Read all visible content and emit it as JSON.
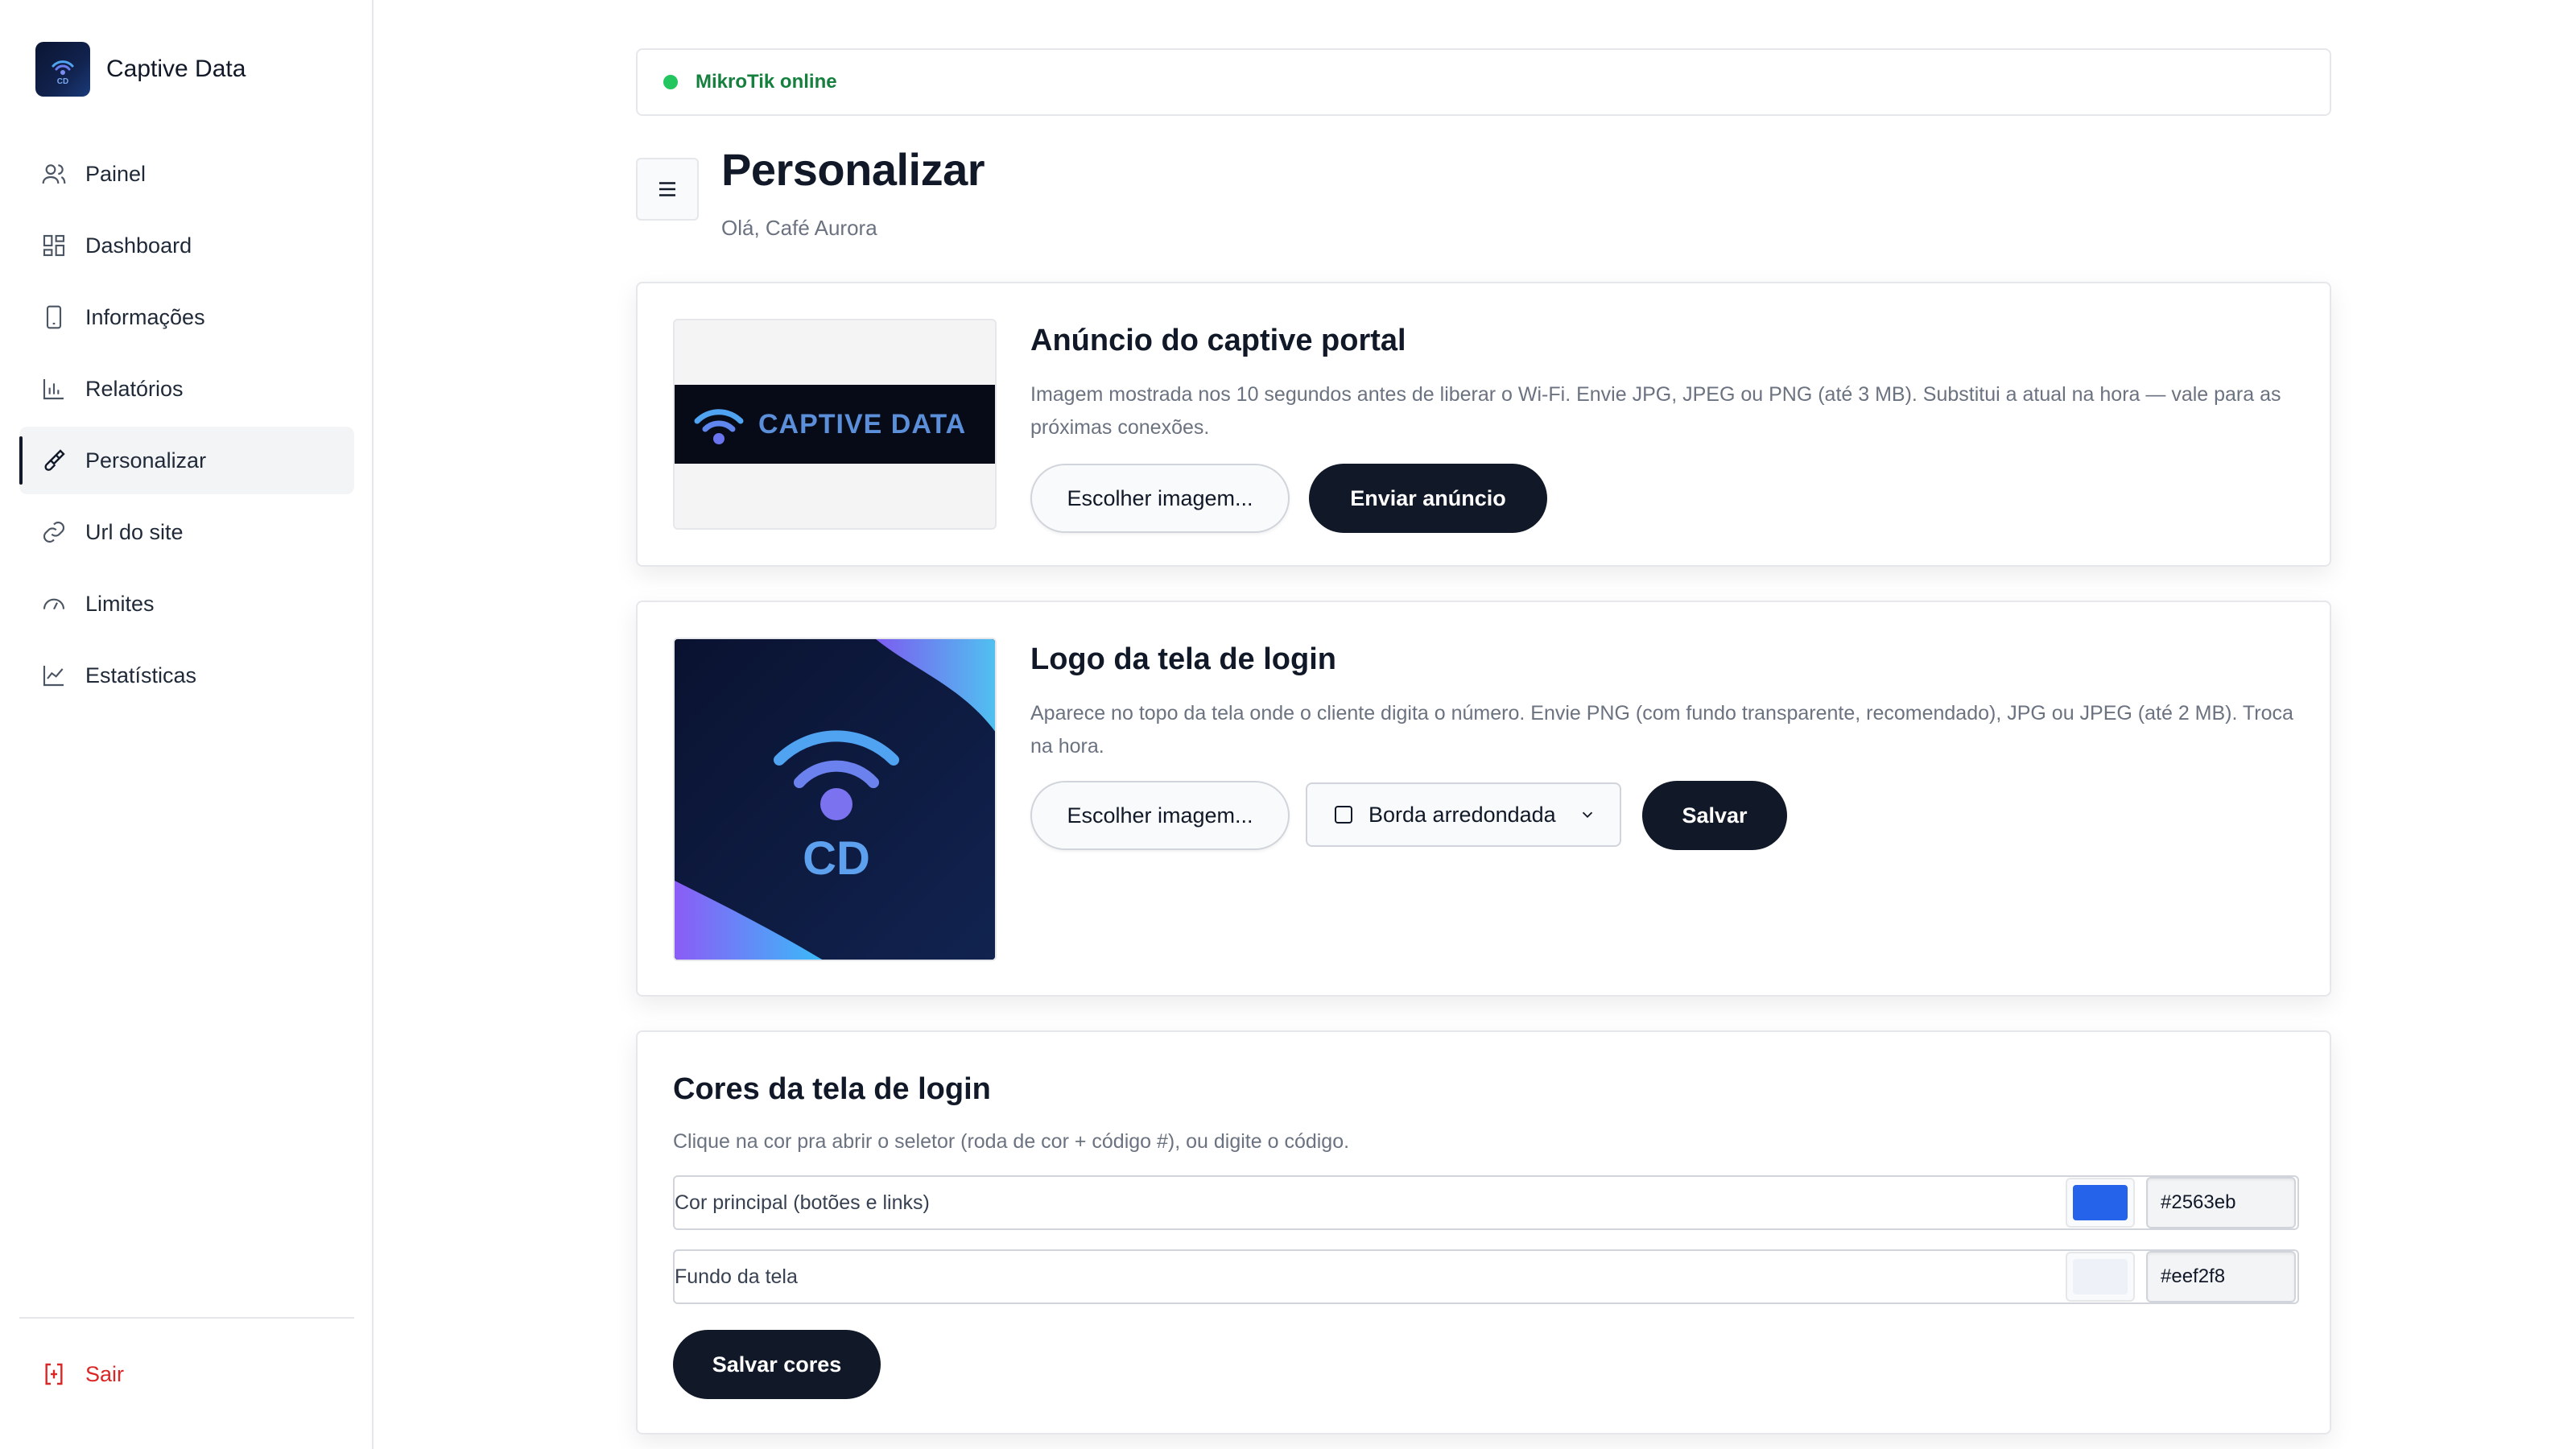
{
  "app": {
    "name": "Captive Data"
  },
  "sidebar": {
    "items": [
      {
        "label": "Painel",
        "icon": "users-icon"
      },
      {
        "label": "Dashboard",
        "icon": "grid-icon"
      },
      {
        "label": "Informações",
        "icon": "phone-icon"
      },
      {
        "label": "Relatórios",
        "icon": "bar-chart-icon"
      },
      {
        "label": "Personalizar",
        "icon": "brush-icon",
        "active": true
      },
      {
        "label": "Url do site",
        "icon": "link-icon"
      },
      {
        "label": "Limites",
        "icon": "gauge-icon"
      },
      {
        "label": "Estatísticas",
        "icon": "line-chart-icon"
      }
    ],
    "logout": "Sair"
  },
  "status": {
    "text": "MikroTik online",
    "color": "#22c55e"
  },
  "header": {
    "title": "Personalizar",
    "greeting": "Olá, Café Aurora"
  },
  "ad_card": {
    "title": "Anúncio do captive portal",
    "description": "Imagem mostrada nos 10 segundos antes de liberar o Wi-Fi. Envie JPG, JPEG ou PNG (até 3 MB). Substitui a atual na hora — vale para as próximas conexões.",
    "choose_label": "Escolher imagem...",
    "submit_label": "Enviar anúncio",
    "banner_text": "CAPTIVE DATA"
  },
  "logo_card": {
    "title": "Logo da tela de login",
    "description": "Aparece no topo da tela onde o cliente digita o número. Envie PNG (com fundo transparente, recomendado), JPG ou JPEG (até 2 MB). Troca na hora.",
    "choose_label": "Escolher imagem...",
    "border_option": "Borda arredondada",
    "save_label": "Salvar",
    "logo_text": "CD"
  },
  "colors_card": {
    "title": "Cores da tela de login",
    "description": "Clique na cor pra abrir o seletor (roda de cor + código #), ou digite o código.",
    "rows": [
      {
        "label": "Cor principal (botões e links)",
        "value": "#2563eb"
      },
      {
        "label": "Fundo da tela",
        "value": "#eef2f8"
      }
    ],
    "save_label": "Salvar cores"
  }
}
